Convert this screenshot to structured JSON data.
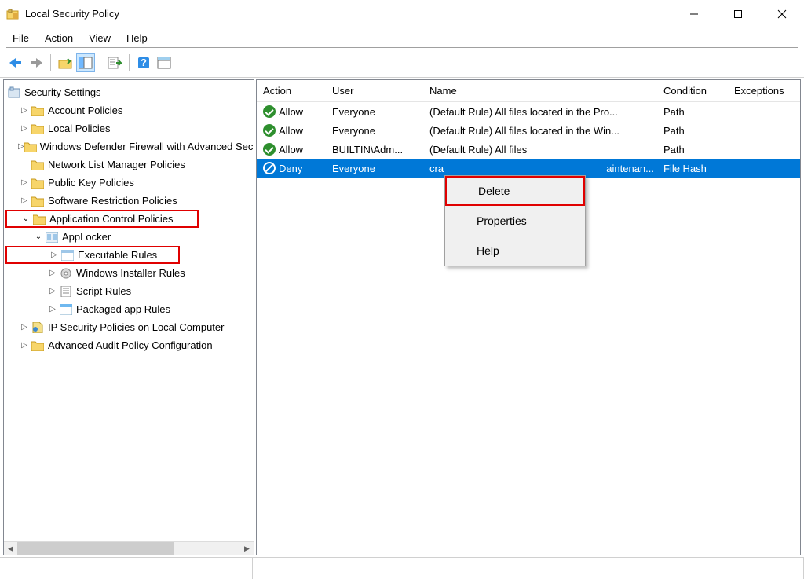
{
  "window": {
    "title": "Local Security Policy"
  },
  "menu": {
    "file": "File",
    "action": "Action",
    "view": "View",
    "help": "Help"
  },
  "tree": {
    "root": "Security Settings",
    "account_policies": "Account Policies",
    "local_policies": "Local Policies",
    "defender_firewall": "Windows Defender Firewall with Advanced Security",
    "network_list": "Network List Manager Policies",
    "public_key": "Public Key Policies",
    "software_restriction": "Software Restriction Policies",
    "app_control": "Application Control Policies",
    "applocker": "AppLocker",
    "executable_rules": "Executable Rules",
    "windows_installer_rules": "Windows Installer Rules",
    "script_rules": "Script Rules",
    "packaged_app_rules": "Packaged app Rules",
    "ip_security": "IP Security Policies on Local Computer",
    "advanced_audit": "Advanced Audit Policy Configuration"
  },
  "columns": {
    "action": "Action",
    "user": "User",
    "name": "Name",
    "condition": "Condition",
    "exceptions": "Exceptions"
  },
  "rows": [
    {
      "action": "Allow",
      "user": "Everyone",
      "name": "(Default Rule) All files located in the Pro...",
      "condition": "Path"
    },
    {
      "action": "Allow",
      "user": "Everyone",
      "name": "(Default Rule) All files located in the Win...",
      "condition": "Path"
    },
    {
      "action": "Allow",
      "user": "BUILTIN\\Adm...",
      "name": "(Default Rule) All files",
      "condition": "Path"
    },
    {
      "action": "Deny",
      "user": "Everyone",
      "name_left": "cra",
      "name_right": "aintenan...",
      "condition": "File Hash"
    }
  ],
  "context_menu": {
    "delete": "Delete",
    "properties": "Properties",
    "help": "Help"
  }
}
